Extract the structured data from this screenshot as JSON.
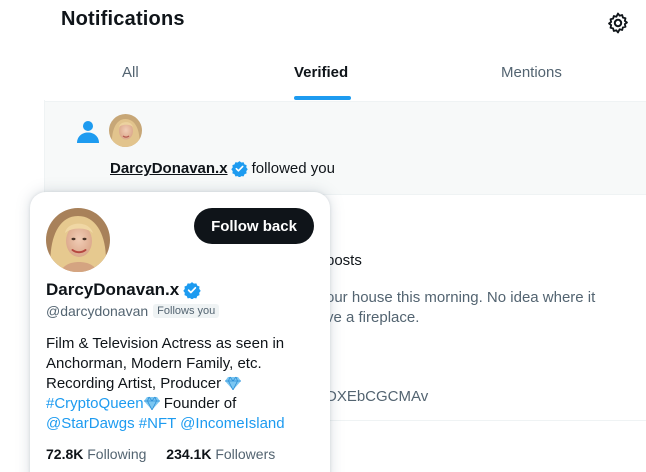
{
  "header": {
    "title": "Notifications",
    "settings_icon": "gear-icon"
  },
  "tabs": [
    {
      "label": "All",
      "active": false
    },
    {
      "label": "Verified",
      "active": true
    },
    {
      "label": "Mentions",
      "active": false
    }
  ],
  "colors": {
    "accent": "#1d9bf0",
    "text": "#0f1419",
    "muted": "#536471",
    "button": "#0f1419"
  },
  "notifications": [
    {
      "type": "follow",
      "icon": "person-icon",
      "username": "DarcyDonavan.x",
      "action": "followed you"
    },
    {
      "type": "posts",
      "posts_fragment": "posts",
      "body_line1": "our house this morning. No idea where it",
      "body_line2": "ve a fireplace.",
      "link_fragment": "DXEbCGCMAv"
    }
  ],
  "hover_card": {
    "name": "DarcyDonavan.x",
    "handle": "@darcydonavan",
    "follows_you": "Follows you",
    "follow_button": "Follow back",
    "bio": {
      "line1": "Film & Television Actress as seen in",
      "line2": "Anchorman, Modern Family, etc.",
      "line3": "Recording Artist, Producer",
      "hashtag_crypto": "#CryptoQueen",
      "line4_rest": " Founder of",
      "mention_stardawgs": "@StarDawgs",
      "hashtag_nft": "#NFT",
      "mention_incomeisland": "@IncomeIsland"
    },
    "following_count": "72.8K",
    "following_label": "Following",
    "followers_count": "234.1K",
    "followers_label": "Followers"
  }
}
